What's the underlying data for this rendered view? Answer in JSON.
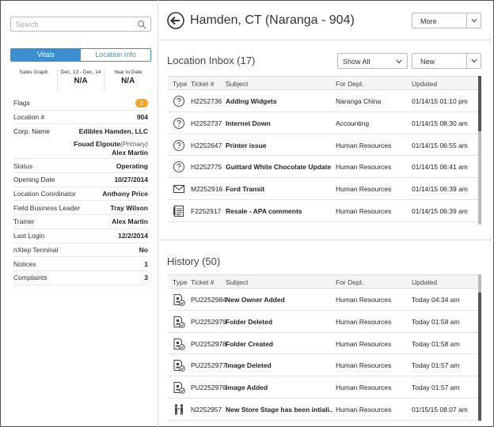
{
  "search": {
    "placeholder": "Search"
  },
  "tabs": {
    "vitals": "Vitals",
    "location_info": "Location Info"
  },
  "stats": [
    {
      "label": "Sales Graph",
      "value": ""
    },
    {
      "label": "Dec, 13 - Dec, 14",
      "value": "N/A"
    },
    {
      "label": "Year to Date",
      "value": "N/A"
    }
  ],
  "props": {
    "flags_label": "Flags",
    "flags_value": "1",
    "location_label": "Location #",
    "location_value": "904",
    "corp_label": "Corp. Name",
    "corp_value": "Edibles Hamden, LLC",
    "owner1_name": "Fouad Elgoute",
    "owner1_role": "(Primary)",
    "owner2_name": "Alex Martin",
    "rows": [
      {
        "k": "Status",
        "v": "Operating"
      },
      {
        "k": "Opening Date",
        "v": "10/27/2014"
      },
      {
        "k": "Location Coordinator",
        "v": "Anthony Price"
      },
      {
        "k": "Field Business Leader",
        "v": "Tray Wilson"
      },
      {
        "k": "Trainer",
        "v": "Alex Martin"
      },
      {
        "k": "Last Login",
        "v": "12/2/2014"
      },
      {
        "k": "nXtep Terminal",
        "v": "No"
      },
      {
        "k": "Notices",
        "v": "1"
      },
      {
        "k": "Complaints",
        "v": "3"
      }
    ]
  },
  "header": {
    "title": "Hamden, CT (Naranga - 904)",
    "more": "More"
  },
  "inbox": {
    "title": "Location Inbox (17)",
    "filter": "Show All",
    "new_label": "New",
    "columns": [
      "Type",
      "Ticket #",
      "Subject",
      "For Dept.",
      "Updated"
    ],
    "rows": [
      {
        "icon": "question-icon",
        "ticket": "H2252736",
        "subject": "Adding Widgets",
        "dept": "Naranga China",
        "updated": "01/14/15 01:10 pm"
      },
      {
        "icon": "question-icon",
        "ticket": "H2252737",
        "subject": "Internet Down",
        "dept": "Accounting",
        "updated": "01/14/15 08:30 am"
      },
      {
        "icon": "question-icon",
        "ticket": "H2252647",
        "subject": "Printer issue",
        "dept": "Human Resources",
        "updated": "01/14/15 06:55 am"
      },
      {
        "icon": "question-icon",
        "ticket": "H2252775",
        "subject": "Guittard White Chocolate Update",
        "dept": "Human Resources",
        "updated": "01/14/15 06:41 am"
      },
      {
        "icon": "envelope-icon",
        "ticket": "M2252916",
        "subject": "Ford Transit",
        "dept": "Human Resources",
        "updated": "01/14/15 06:39 am"
      },
      {
        "icon": "form-icon",
        "ticket": "F2252917",
        "subject": "Resale - APA comments",
        "dept": "Human Resources",
        "updated": "01/14/15 06:39 am"
      }
    ]
  },
  "history": {
    "title": "History (50)",
    "columns": [
      "Type",
      "Ticket #",
      "Subject",
      "For Dept.",
      "Updated"
    ],
    "rows": [
      {
        "icon": "document-user-icon",
        "ticket": "PU2252984",
        "subject": "New Owner Added",
        "dept": "Human Resources",
        "updated": "Today 04:34 am"
      },
      {
        "icon": "document-user-icon",
        "ticket": "PU2252979",
        "subject": "Folder Deleted",
        "dept": "Human Resources",
        "updated": "Today 01:58 am"
      },
      {
        "icon": "document-user-icon",
        "ticket": "PU2252978",
        "subject": "Folder Created",
        "dept": "Human Resources",
        "updated": "Today 01:58 am"
      },
      {
        "icon": "document-user-icon",
        "ticket": "PU2252977",
        "subject": "Image Deleted",
        "dept": "Human Resources",
        "updated": "Today 01:57 am"
      },
      {
        "icon": "document-user-icon",
        "ticket": "PU2252976",
        "subject": "Image Added",
        "dept": "Human Resources",
        "updated": "Today 01:57 am"
      },
      {
        "icon": "people-icon",
        "ticket": "N2252957",
        "subject": "New Store Stage has been intiali...",
        "dept": "Human Resources",
        "updated": "01/15/15 08:07 am"
      }
    ]
  }
}
